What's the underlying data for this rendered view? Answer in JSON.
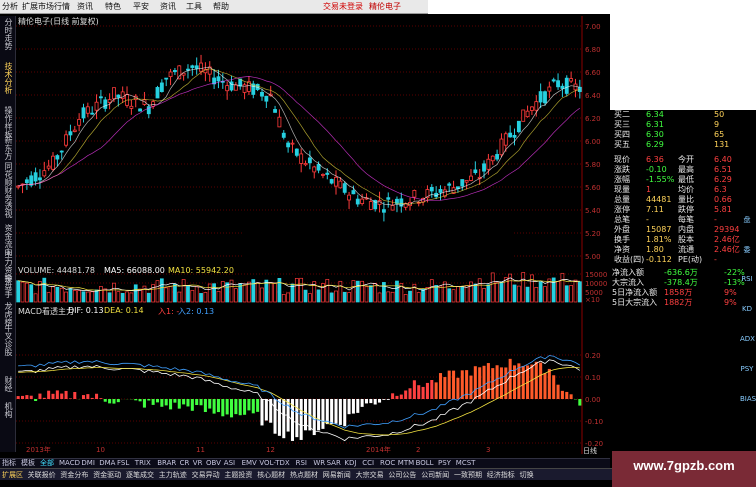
{
  "menu": {
    "items": [
      "分析",
      "扩展市场行情",
      "资讯",
      "特色",
      "平安",
      "资讯",
      "工具",
      "帮助"
    ],
    "trade_status": "交易未登录",
    "brand": "精伦电子"
  },
  "vertical_tabs": [
    "分时走势",
    "技术分析",
    "操作样板",
    "新东方",
    "同花顺",
    "财务透视",
    "资金流向",
    "主力资金",
    "操盘手",
    "龙虎榜",
    "牛叉诊股",
    "财经",
    "机构"
  ],
  "price_panel": {
    "title": "精伦电子(日线 前复权)",
    "y_ticks": [
      "7.00",
      "6.80",
      "6.60",
      "6.40",
      "6.20",
      "6.00",
      "5.80",
      "5.60",
      "5.40",
      "5.20",
      "5.00"
    ],
    "y_min": 5.0,
    "y_max": 7.0
  },
  "volume_panel": {
    "label_vol": "VOLUME: 44481.78",
    "label_ma5": "MA5: 66088.00",
    "label_ma10": "MA10: 55942.20",
    "y_ticks": [
      "15000",
      "10000",
      "5000"
    ],
    "unit": "×10"
  },
  "macd_panel": {
    "label_name": "MACD看透主力",
    "label_dif": "DIF: 0.13",
    "label_dea": "DEA: 0.14",
    "label_in1": "入1: -",
    "label_in2": "入2: 0.13",
    "y_ticks": [
      "0.20",
      "0.10",
      "0.00",
      "-0.10",
      "-0.20"
    ]
  },
  "time_axis": {
    "labels": [
      "2013年",
      "10",
      "11",
      "12",
      "2014年",
      "2",
      "3"
    ],
    "cycle": "日线"
  },
  "quote": {
    "rows": [
      {
        "k1": "买二",
        "v1": "6.34",
        "v2": "50"
      },
      {
        "k1": "买三",
        "v1": "6.31",
        "v2": "9"
      },
      {
        "k1": "买四",
        "v1": "6.30",
        "v2": "65"
      },
      {
        "k1": "买五",
        "v1": "6.29",
        "v2": "131"
      },
      {
        "k1": "现价",
        "v1": "6.36",
        "k2": "今开",
        "v2": "6.40"
      },
      {
        "k1": "涨跌",
        "v1": "-0.10",
        "k2": "最高",
        "v2": "6.51"
      },
      {
        "k1": "涨幅",
        "v1": "-1.55%",
        "k2": "最低",
        "v2": "6.29"
      },
      {
        "k1": "现量",
        "v1": "1",
        "k2": "均价",
        "v2": "6.3"
      },
      {
        "k1": "总量",
        "v1": "44481",
        "k2": "量比",
        "v2": "0.66"
      },
      {
        "k1": "涨停",
        "v1": "7.11",
        "k2": "跌停",
        "v2": "5.81"
      },
      {
        "k1": "总笔",
        "v1": "-",
        "k2": "每笔",
        "v2": "-"
      },
      {
        "k1": "外盘",
        "v1": "15087",
        "k2": "内盘",
        "v2": "29394"
      },
      {
        "k1": "换手",
        "v1": "1.81%",
        "k2": "股本",
        "v2": "2.46亿"
      },
      {
        "k1": "净资",
        "v1": "1.80",
        "k2": "流通",
        "v2": "2.46亿"
      },
      {
        "k1": "收益(四)",
        "v1": "-0.112",
        "k2": "PE(动)",
        "v2": "-"
      },
      {
        "k1": "净流入额",
        "v1": "-636.6万",
        "v2": "-22%"
      },
      {
        "k1": "大宗流入",
        "v1": "-378.4万",
        "v2": "-13%"
      },
      {
        "k1": "5日净流入额",
        "v1": "1858万",
        "v2": "9%"
      },
      {
        "k1": "5日大宗流入",
        "v1": "1882万",
        "v2": "9%"
      }
    ]
  },
  "right_tools": [
    "盘",
    "委",
    "RSI",
    "KD",
    "ADX",
    "PSY",
    "BIAS"
  ],
  "indicator_tabs": [
    "指标",
    "模板",
    "全部",
    "MACD",
    "DMI",
    "DMA",
    "FSL",
    "TRIX",
    "BRAR",
    "CR",
    "VR",
    "OBV",
    "ASI",
    "EMV",
    "VOL-TDX",
    "RSI",
    "WR",
    "SAR",
    "KDJ",
    "CCI",
    "ROC",
    "MTM",
    "BOLL",
    "PSY",
    "MCST"
  ],
  "bottom_tabs": [
    "扩展区",
    "关联报价",
    "资金分布",
    "资金驱动",
    "逐笔成交",
    "主力轨迹",
    "交易异动",
    "主题投资",
    "核心题材",
    "热点题材",
    "网易新闻",
    "大宗交易",
    "公司公告",
    "公司新闻",
    "一致预期",
    "经济指标",
    "切换"
  ],
  "watermark": "www.7gpzb.com",
  "colors": {
    "up": "#ff3b3b",
    "down": "#26d0e0",
    "ma5": "#ffffff",
    "ma10": "#f0e040",
    "dif": "#ffffff",
    "dea": "#f0e040",
    "in1": "#ff4040",
    "in2": "#40a0ff"
  }
}
